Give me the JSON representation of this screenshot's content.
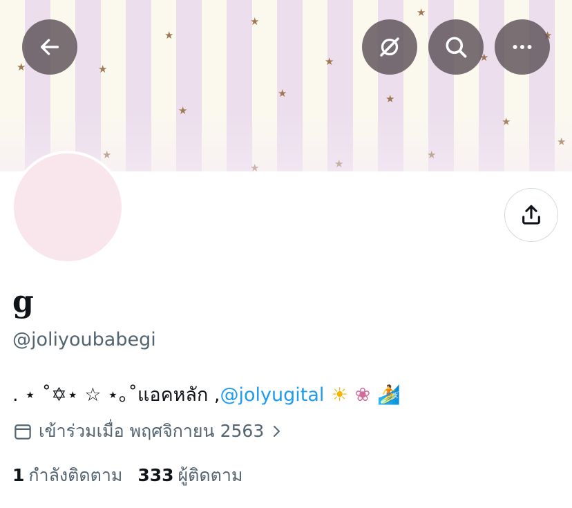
{
  "profile": {
    "display_name": "g",
    "handle": "@joliyoubabegi",
    "bio": {
      "decor": ". ⋆ ˚✡⋆ ☆ ⋆｡˚",
      "text": " แอคหลัก , ",
      "mention": "@jolyugital",
      "emoji_sun": "☀",
      "emoji_lotus": "❀",
      "emoji_surf": "🏄"
    },
    "joined": "เข้าร่วมเมื่อ พฤศจิกายน 2563",
    "following_count": "1",
    "following_label": "กำลังติดตาม",
    "followers_count": "333",
    "followers_label": "ผู้ติดตาม"
  },
  "header_buttons": {
    "back": "arrow-left-icon",
    "grok": "grok-slash-icon",
    "search": "search-icon",
    "more": "more-dots-icon"
  },
  "colors": {
    "accent": "#1d9bf0",
    "secondary_text": "#536471",
    "primary_text": "#0f1419",
    "header_button_bg": "#5d5258",
    "avatar_fill": "#f8e6ec",
    "banner_stripe_light": "#fbf9ee",
    "banner_stripe_pink": "#ecdeec",
    "banner_star": "#9e7754"
  }
}
